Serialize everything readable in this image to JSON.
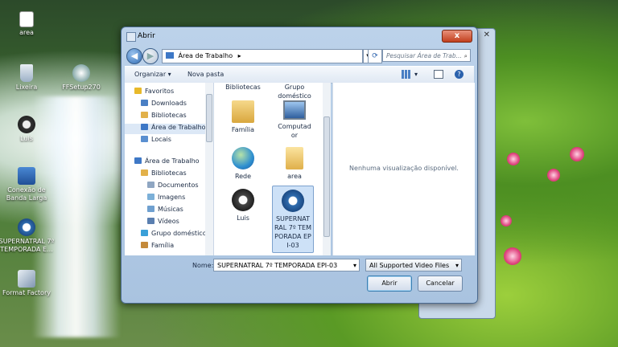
{
  "desktop": {
    "icons": [
      {
        "label": "area",
        "name": "desktop-icon-area"
      },
      {
        "label": "Lixeira",
        "name": "desktop-icon-lixeira"
      },
      {
        "label": "FFSetup270",
        "name": "desktop-icon-ffsetup"
      },
      {
        "label": "Luis",
        "name": "desktop-icon-luis"
      },
      {
        "label": "Conexão de Banda Larga",
        "name": "desktop-icon-conexao"
      },
      {
        "label": "SUPERNATRAL 7º TEMPORADA E...",
        "name": "desktop-icon-supernatral"
      },
      {
        "label": "Format Factory",
        "name": "desktop-icon-format-factory"
      }
    ]
  },
  "dialog": {
    "title": "Abrir",
    "close_label": "x",
    "address": {
      "current": "Área de Trabalho",
      "separator": "▸",
      "search_placeholder": "Pesquisar Área de Trab..."
    },
    "toolbar": {
      "organize": "Organizar ▾",
      "new_folder": "Nova pasta"
    },
    "nav": {
      "items": [
        {
          "label": "Favoritos",
          "icon": "star-icon",
          "color": "#e8b92a"
        },
        {
          "label": "Downloads",
          "icon": "downloads-icon",
          "color": "#4a7fc4"
        },
        {
          "label": "Bibliotecas",
          "icon": "libraries-icon",
          "color": "#e2b14a"
        },
        {
          "label": "Área de Trabalho",
          "icon": "desktop-folder-icon",
          "color": "#3e78c6"
        },
        {
          "label": "Locais",
          "icon": "places-icon",
          "color": "#5a8fd0"
        },
        {
          "label": "Área de Trabalho",
          "icon": "desktop-folder-icon",
          "color": "#3e78c6"
        },
        {
          "label": "Bibliotecas",
          "icon": "libraries-icon",
          "color": "#e2b14a"
        },
        {
          "label": "Documentos",
          "icon": "documents-icon",
          "color": "#8fa6c2"
        },
        {
          "label": "Imagens",
          "icon": "images-icon",
          "color": "#7cb0d8"
        },
        {
          "label": "Músicas",
          "icon": "music-icon",
          "color": "#6fa0d0"
        },
        {
          "label": "Vídeos",
          "icon": "videos-icon",
          "color": "#5a7fb0"
        },
        {
          "label": "Grupo doméstico",
          "icon": "homegroup-icon",
          "color": "#3aa0d8"
        },
        {
          "label": "Família",
          "icon": "family-icon",
          "color": "#c48a3a"
        }
      ]
    },
    "files": {
      "top_partial": [
        "Bibliotecas",
        "Grupo doméstico"
      ],
      "items": [
        {
          "label": "Família",
          "icon": "user-folder-icon"
        },
        {
          "label": "Computador",
          "icon": "computer-icon"
        },
        {
          "label": "Rede",
          "icon": "network-icon"
        },
        {
          "label": "area",
          "icon": "folder-icon"
        },
        {
          "label": "Luis",
          "icon": "clock-icon"
        },
        {
          "label": "SUPERNATRAL 7º TEMPORADA EPI-03",
          "icon": "video-file-icon",
          "selected": true
        }
      ]
    },
    "preview_text": "Nenhuma visualização disponível.",
    "name_label": "Nome:",
    "filename": "SUPERNATRAL 7º TEMPORADA EPI-03",
    "filter": "All Supported Video Files",
    "open_label": "Abrir",
    "cancel_label": "Cancelar"
  }
}
